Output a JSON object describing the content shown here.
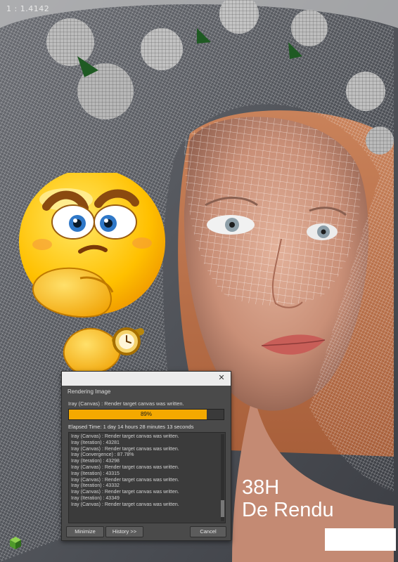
{
  "viewport": {
    "frame_label": "1 : 1.4142"
  },
  "caption": {
    "line1": "38H",
    "line2": "De Rendu"
  },
  "render_dialog": {
    "heading": "Rendering Image",
    "status": "Iray (Canvas) : Render target canvas was written.",
    "progress": {
      "value": 0.89,
      "label": "89%"
    },
    "elapsed": "Elapsed Time:  1 day 14 hours 28 minutes 13 seconds",
    "log": [
      "Iray (Canvas) : Render target canvas was written.",
      "Iray (Iteration) : 43281",
      "Iray (Canvas) : Render target canvas was written.",
      "Iray (Convergence) : 87.78%",
      "Iray (Iteration) : 43298",
      "Iray (Canvas) : Render target canvas was written.",
      "Iray (Iteration) : 43315",
      "Iray (Canvas) : Render target canvas was written.",
      "Iray (Iteration) : 43332",
      "Iray (Canvas) : Render target canvas was written.",
      "Iray (Iteration) : 43349",
      "Iray (Canvas) : Render target canvas was written."
    ],
    "buttons": {
      "minimize": "Minimize",
      "history": "History >>",
      "cancel": "Cancel"
    },
    "close_icon": "close-icon"
  },
  "colors": {
    "progress_fill": "#f4a900",
    "dialog_bg": "#4a4a4a",
    "caption_text": "#ffffff"
  },
  "icons": {
    "emoji": "thinking-emoji-with-watch",
    "corner_logo": "app-cube-logo"
  }
}
